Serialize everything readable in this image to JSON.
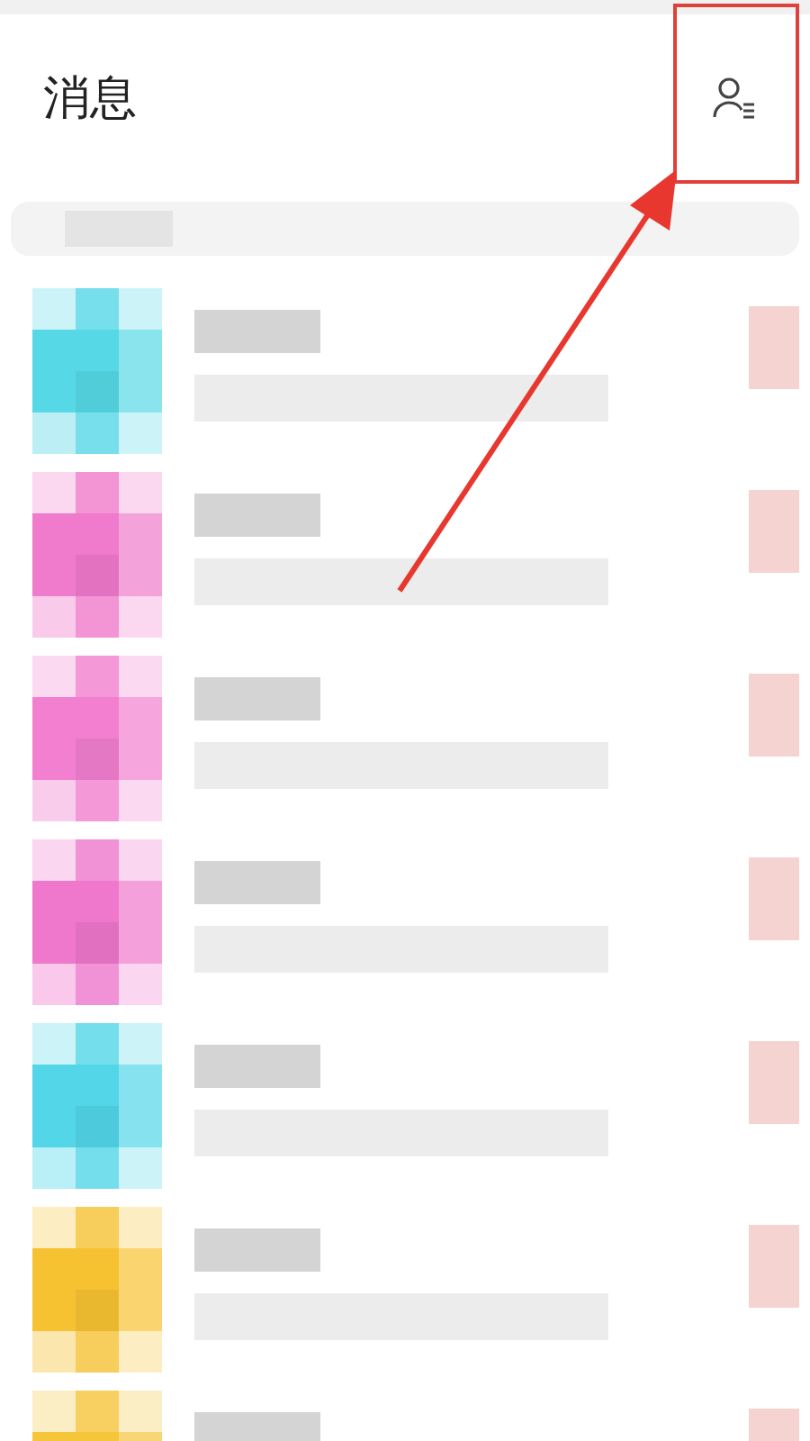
{
  "header": {
    "title": "消息"
  },
  "conversations": [
    {
      "color": "#56d8e6"
    },
    {
      "color": "#f07acb"
    },
    {
      "color": "#f27fcf"
    },
    {
      "color": "#ef77cc"
    },
    {
      "color": "#52d6e8"
    },
    {
      "color": "#f6c232"
    },
    {
      "color": "#f5c53a"
    }
  ]
}
